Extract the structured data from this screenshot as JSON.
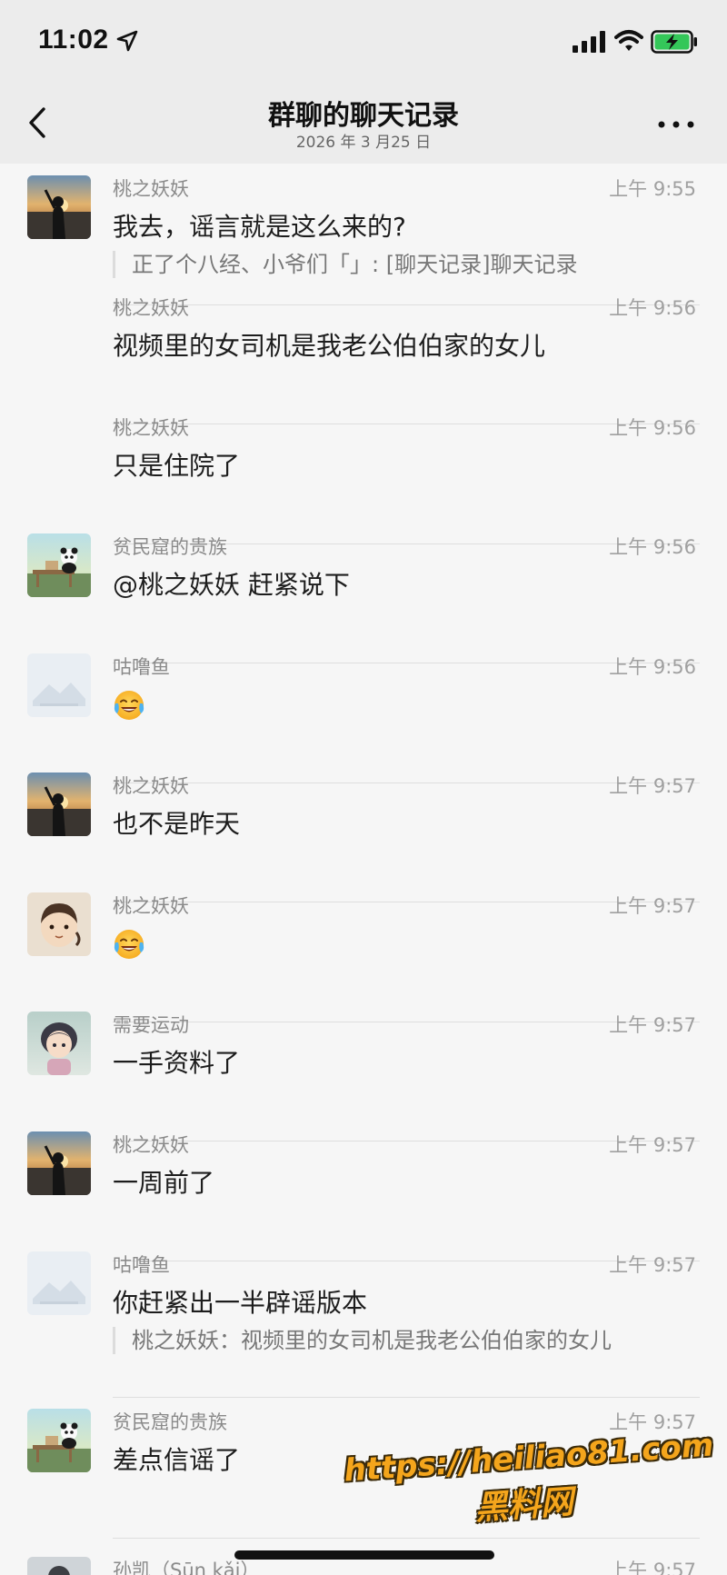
{
  "status_bar": {
    "time": "11:02"
  },
  "nav": {
    "title": "群聊的聊天记录",
    "subtitle": "2026 年 3 月25 日"
  },
  "messages": [
    {
      "sender": "桃之妖妖",
      "time": "上午 9:55",
      "text": "我去，谣言就是这么来的?",
      "quote": "正了个八经、小爷们「」: [聊天记录]聊天记录",
      "avatar": "sunset-silhouette"
    },
    {
      "sender": "桃之妖妖",
      "time": "上午 9:56",
      "text": "视频里的女司机是我老公伯伯家的女儿"
    },
    {
      "sender": "桃之妖妖",
      "time": "上午 9:56",
      "text": "只是住院了"
    },
    {
      "sender": "贫民窟的贵族",
      "time": "上午 9:56",
      "text": "@桃之妖妖 赶紧说下",
      "avatar": "panda-scene"
    },
    {
      "sender": "咕噜鱼",
      "time": "上午 9:56",
      "emoji": "laugh-cry-emoji",
      "avatar": "placeholder-image"
    },
    {
      "sender": "桃之妖妖",
      "time": "上午 9:57",
      "text": "也不是昨天",
      "avatar": "sunset-silhouette"
    },
    {
      "sender": "桃之妖妖",
      "time": "上午 9:57",
      "emoji": "laugh-cry-emoji",
      "avatar": "cartoon-girl"
    },
    {
      "sender": "需要运动",
      "time": "上午 9:57",
      "text": "一手资料了",
      "avatar": "anime-girl"
    },
    {
      "sender": "桃之妖妖",
      "time": "上午 9:57",
      "text": "一周前了",
      "avatar": "sunset-silhouette"
    },
    {
      "sender": "咕噜鱼",
      "time": "上午 9:57",
      "text": "你赶紧出一半辟谣版本",
      "quote": "桃之妖妖：视频里的女司机是我老公伯伯家的女儿",
      "avatar": "placeholder-image"
    },
    {
      "sender": "贫民窟的贵族",
      "time": "上午 9:57",
      "text": "差点信谣了",
      "avatar": "panda-scene"
    },
    {
      "sender": "孙凯（Sūn kǎi）",
      "time": "上午 9:57",
      "text": ""
    }
  ],
  "watermark": {
    "url": "https://heiliao81.com",
    "name": "黑料网"
  }
}
